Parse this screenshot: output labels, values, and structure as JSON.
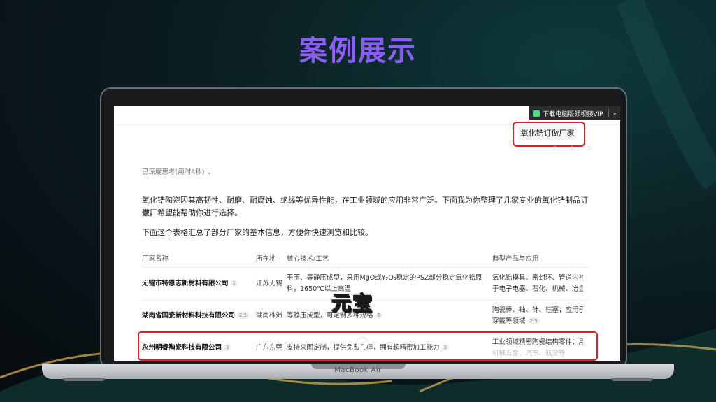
{
  "slide": {
    "title": "案例展示",
    "laptop_brand": "MacBook Air",
    "watermark": "元宝"
  },
  "topbar": {
    "vip_label": "下载电脑版领视频VIP",
    "dropdown_glyph": "⌄"
  },
  "chat": {
    "user_query": "氧化锆订做厂家",
    "faded_meta": "2 · 1 · 2",
    "thinking_label": "已深度思考(用时4秒)",
    "thinking_chevron": "⌄",
    "intro_line1": "氧化锆陶瓷因其高韧性、耐磨、耐腐蚀、绝缘等优异性能，在工业领域的应用非常广泛。下面我为你整理了几家专业的氧化锆制品订做厂",
    "intro_line2": "家，希望能帮助你进行选择。",
    "summary": "下面这个表格汇总了部分厂家的基本信息，方便你快速浏览和比较。"
  },
  "table": {
    "headers": [
      "厂家名称",
      "所在地",
      "核心技术/工艺",
      "典型产品与应用"
    ],
    "rows": [
      {
        "name": "无锡市特恩志新材料有限公司",
        "name_refs": "1",
        "location": "江苏无锡",
        "tech_line1": "干压、等静压成型，采用MgO或Y₂O₃稳定的PSZ部分稳定氧化锆原",
        "tech_line2": "料，1650℃以上高温",
        "products_line1": "氧化锆模具、密封环、管道内衬",
        "products_line2": "于电子电器、石化、机械、冶金"
      },
      {
        "name": "湖南省国瓷新材料科技有限公司",
        "name_refs": "2 5",
        "location": "湖南株洲",
        "tech_line1": "等静压成型，可定制多种规格",
        "tech_refs": "5",
        "products_line1": "陶瓷棒、轴、针、柱塞；应用于",
        "products_line2": "穿戴等领域",
        "products_refs": "2 5"
      },
      {
        "name": "永州明睿陶瓷科技有限公司",
        "name_refs": "3",
        "location": "广东东莞",
        "tech_line1": "支持来图定制，提供免费打样，拥有超精密加工能力",
        "tech_refs": "3",
        "products_line1": "工业领域精密陶瓷结构零件；用",
        "products_line2": "机械五金、汽车、航空等"
      }
    ]
  },
  "colors": {
    "title": "#8b5cf6",
    "highlight": "#e11d2a",
    "watermark": "#ffd400"
  }
}
